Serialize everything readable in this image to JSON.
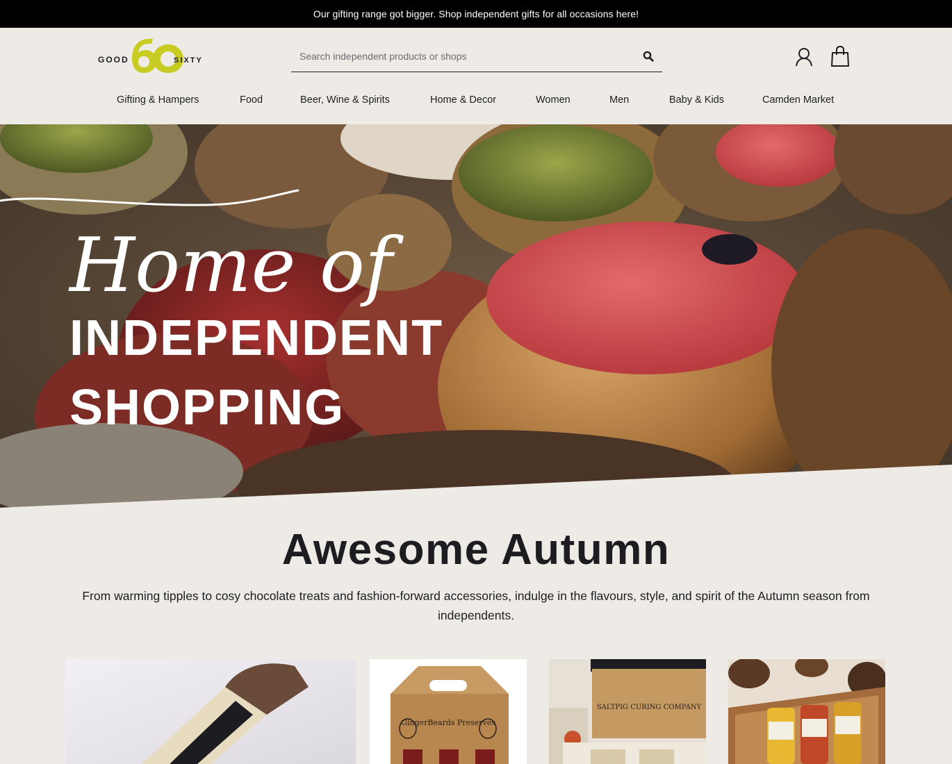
{
  "announcement": {
    "text": "Our gifting range got bigger. Shop independent gifts for all occasions here!"
  },
  "logo": {
    "left_word": "GOOD",
    "number": "60",
    "right_word": "SIXTY",
    "brand_color": "#c8cc22"
  },
  "search": {
    "placeholder": "Search independent products or shops",
    "value": ""
  },
  "icons": {
    "search": "search-icon",
    "account": "user-icon",
    "bag": "shopping-bag-icon"
  },
  "nav": {
    "items": [
      {
        "label": "Gifting & Hampers"
      },
      {
        "label": "Food"
      },
      {
        "label": "Beer, Wine & Spirits"
      },
      {
        "label": "Home & Decor"
      },
      {
        "label": "Women"
      },
      {
        "label": "Men"
      },
      {
        "label": "Baby & Kids"
      },
      {
        "label": "Camden Market"
      }
    ]
  },
  "hero": {
    "script_line": "Home of",
    "line1": "INDEPENDENT",
    "line2": "SHOPPING"
  },
  "promo": {
    "title": "Awesome Autumn",
    "text": "From warming tipples to cosy chocolate treats and fashion-forward accessories, indulge in the flavours, style, and spirit of the Autumn season from independents."
  },
  "cards": [
    {
      "box_text": ""
    },
    {
      "box_text": "GingerBeards Preserves"
    },
    {
      "box_text": "SALTPIG CURING COMPANY"
    },
    {
      "box_text": ""
    }
  ],
  "colors": {
    "background": "#eeebe6",
    "text": "#1d1d21",
    "announcement_bg": "#000000"
  }
}
